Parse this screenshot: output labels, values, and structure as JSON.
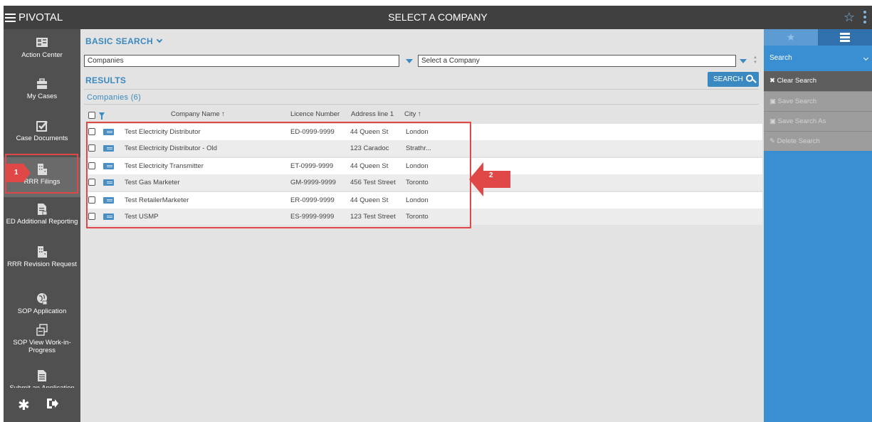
{
  "topbar": {
    "brand": "PIVOTAL",
    "title": "SELECT A COMPANY"
  },
  "sidebar": {
    "items": [
      {
        "label": "Action Center",
        "icon": "dashboard-icon"
      },
      {
        "label": "My Cases",
        "icon": "briefcase-icon"
      },
      {
        "label": "Case Documents",
        "icon": "checkbox-icon"
      },
      {
        "label": "RRR Filings",
        "icon": "building-icon"
      },
      {
        "label": "ED Additional Reporting",
        "icon": "document-edit-icon"
      },
      {
        "label": "RRR Revision Request",
        "icon": "building-icon"
      },
      {
        "label": "SOP Application",
        "icon": "globe-icon"
      },
      {
        "label": "SOP View Work-in-Progress",
        "icon": "copy-icon"
      },
      {
        "label": "Submit an Application",
        "icon": "document-icon"
      }
    ]
  },
  "callouts": {
    "step1": "1",
    "step2": "2"
  },
  "search": {
    "section_title": "BASIC SEARCH",
    "entity_value": "Companies",
    "company_select": "Select a Company",
    "search_button": "SEARCH"
  },
  "results": {
    "section_title": "RESULTS",
    "list_title": "Companies (6)",
    "columns": [
      "Company Name",
      "Licence Number",
      "Address line 1",
      "City"
    ],
    "rows": [
      {
        "name": "Test Electricity Distributor",
        "licence": "ED-0999-9999",
        "address": "44 Queen St",
        "city": "London"
      },
      {
        "name": "Test Electricity Distributor - Old",
        "licence": "",
        "address": "123 Caradoc",
        "city": "Strathr..."
      },
      {
        "name": "Test Electricity Transmitter",
        "licence": "ET-0999-9999",
        "address": "44 Queen St",
        "city": "London"
      },
      {
        "name": "Test Gas Marketer",
        "licence": "GM-9999-9999",
        "address": "456 Test Street",
        "city": "Toronto"
      },
      {
        "name": "Test RetailerMarketer",
        "licence": "ER-0999-9999",
        "address": "44 Queen St",
        "city": "London"
      },
      {
        "name": "Test USMP",
        "licence": "ES-9999-9999",
        "address": "123 Test Street",
        "city": "Toronto"
      }
    ]
  },
  "right_panel": {
    "select_value": "Search",
    "actions": [
      {
        "label": "Clear Search",
        "enabled": true
      },
      {
        "label": "Save Search",
        "enabled": false
      },
      {
        "label": "Save Search As",
        "enabled": false
      },
      {
        "label": "Delete Search",
        "enabled": false
      }
    ]
  },
  "colors": {
    "accent": "#3a89c0",
    "topbar": "#404040",
    "sidebar": "#505050",
    "right_panel": "#3a8fd3",
    "callout": "#e04848"
  }
}
